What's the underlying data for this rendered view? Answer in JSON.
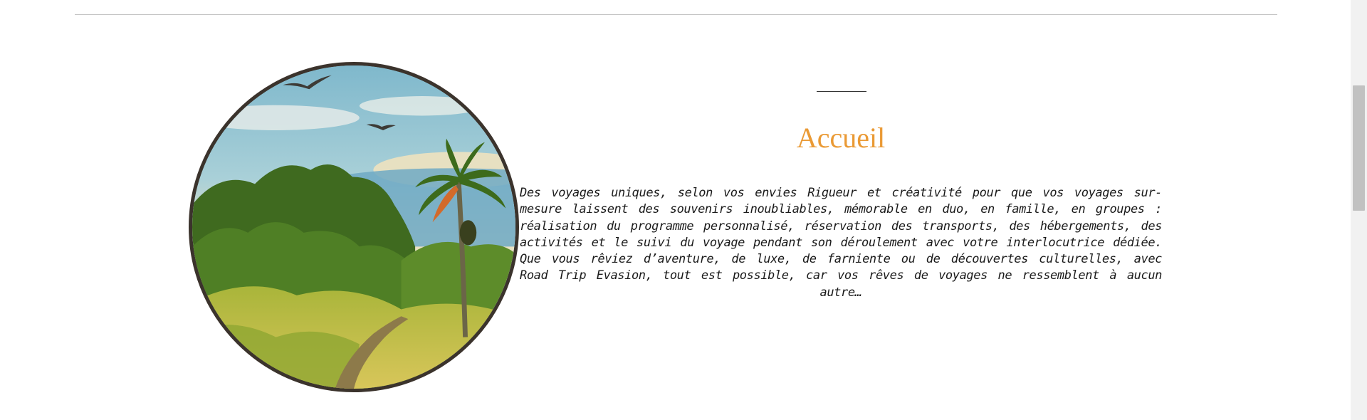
{
  "section": {
    "heading": "Accueil",
    "description": "Des voyages uniques, selon vos envies Rigueur et créativité pour que vos voyages sur-mesure laissent des souvenirs inoubliables, mémorable en duo, en famille, en groupes : réalisation du programme personnalisé, réservation des transports, des hébergements, des activités et le suivi du voyage pendant son déroulement avec votre interlocutrice dédiée. Que vous rêviez d’aventure, de luxe, de farniente ou de découvertes culturelles, avec Road Trip Evasion, tout est possible, car vos rêves de voyages ne ressemblent à aucun autre…",
    "image_subject": "tropical landscape with palm tree, birds and dirt path"
  },
  "colors": {
    "heading": "#ea9a35",
    "text": "#1a1a1a",
    "image_border": "#3b332c",
    "divider": "#c4c4c4"
  },
  "scrollbar": {
    "position_fraction": 0.12
  }
}
